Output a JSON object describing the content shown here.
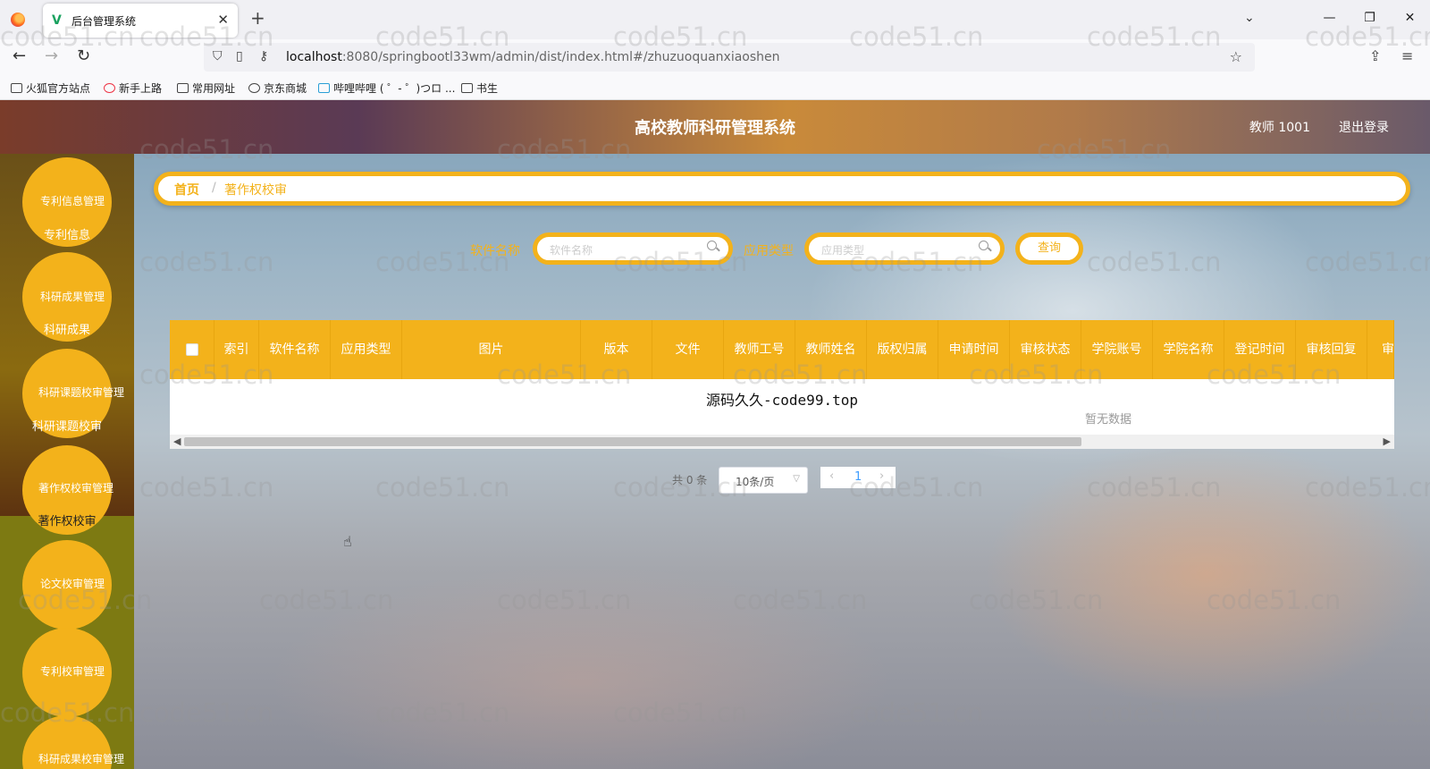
{
  "browser": {
    "tab_title": "后台管理系统",
    "url_host": "localhost",
    "url_rest": ":8080/springbootl33wm/admin/dist/index.html#/zhuzuoquanxiaoshen",
    "bookmarks": [
      "火狐官方站点",
      "新手上路",
      "常用网址",
      "京东商城",
      "哔哩哔哩 ( ゜- ゜)つロ ...",
      "书生"
    ]
  },
  "header": {
    "title": "高校教师科研管理系统",
    "user": "教师 1001",
    "logout": "退出登录"
  },
  "sidebar": {
    "items": [
      {
        "title": "专利信息管理",
        "sub": "专利信息"
      },
      {
        "title": "科研成果管理",
        "sub": "科研成果"
      },
      {
        "title": "科研课题校审管理",
        "sub": "科研课题校审"
      },
      {
        "title": "著作权校审管理",
        "sub": "著作权校审"
      },
      {
        "title": "论文校审管理",
        "sub": ""
      },
      {
        "title": "专利校审管理",
        "sub": ""
      },
      {
        "title": "科研成果校审管理",
        "sub": ""
      }
    ]
  },
  "breadcrumb": {
    "home": "首页",
    "separator": "/",
    "current": "著作权校审"
  },
  "filters": {
    "software_label": "软件名称",
    "software_placeholder": "软件名称",
    "type_label": "应用类型",
    "type_placeholder": "应用类型",
    "query_button": "查询"
  },
  "table": {
    "columns": [
      "索引",
      "软件名称",
      "应用类型",
      "图片",
      "版本",
      "文件",
      "教师工号",
      "教师姓名",
      "版权归属",
      "申请时间",
      "审核状态",
      "学院账号",
      "学院名称",
      "登记时间",
      "审核回复",
      "审"
    ],
    "overlay_text": "源码久久-code99.top",
    "empty_text": "暂无数据"
  },
  "pagination": {
    "total": "共 0 条",
    "page_size": "10条/页",
    "current_page": "1"
  },
  "watermark": "code51.cn",
  "colors": {
    "accent": "#f3b21b"
  }
}
